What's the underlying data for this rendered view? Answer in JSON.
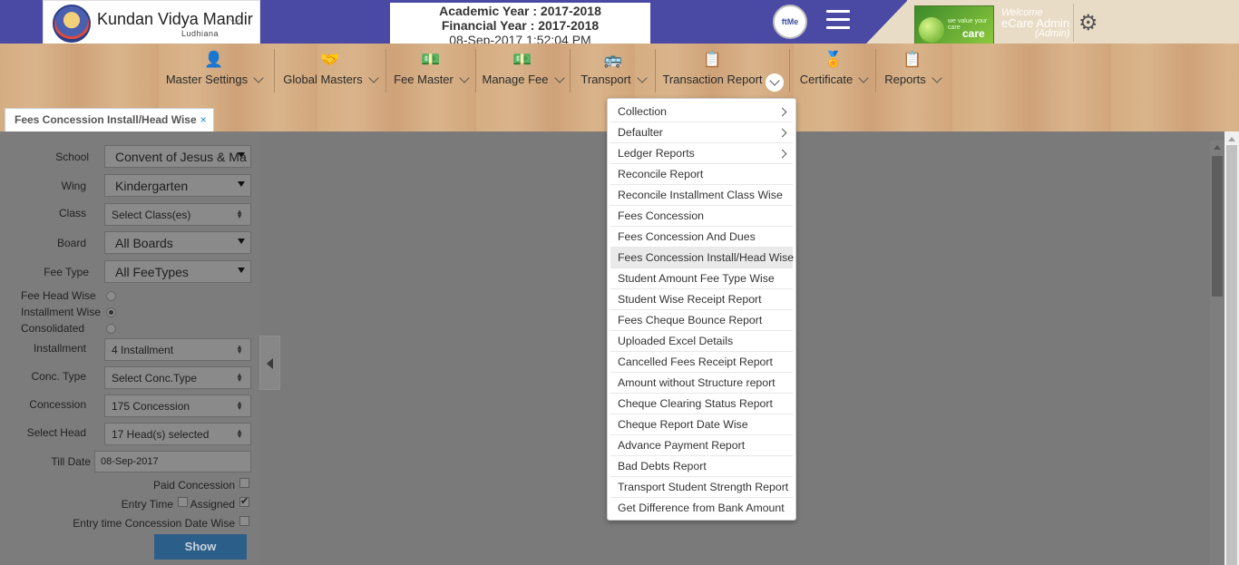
{
  "header": {
    "school_name": "Kundan Vidya Mandir",
    "school_city": "Ludhiana",
    "academic_year": "Academic Year : 2017-2018",
    "financial_year": "Financial Year : 2017-2018",
    "datetime": "08-Sep-2017 1:52:04 PM",
    "ecare_logo_text": "ftMe",
    "brand_tagline": "we value your care",
    "brand_text": "care",
    "welcome": "Welcome",
    "user_name": "eCare Admin",
    "user_role": "(Admin)",
    "colors": {
      "header_bg": "#4a4aa5",
      "accent_button": "#2c5e8a"
    }
  },
  "nav": {
    "items": [
      {
        "label": "Master Settings",
        "icon": "user-edit-icon"
      },
      {
        "label": "Global Masters",
        "icon": "handshake-icon"
      },
      {
        "label": "Fee Master",
        "icon": "money-icon"
      },
      {
        "label": "Manage Fee",
        "icon": "money-icon"
      },
      {
        "label": "Transport",
        "icon": "bus-icon"
      },
      {
        "label": "Transaction Report",
        "icon": "report-icon"
      },
      {
        "label": "Certificate",
        "icon": "certificate-icon"
      },
      {
        "label": "Reports",
        "icon": "report-icon"
      }
    ]
  },
  "tabs": {
    "active_label": "Fees Concession Install/Head Wise",
    "close_glyph": "×"
  },
  "form": {
    "school_label": "School",
    "school_value": "Convent of Jesus & Ma",
    "wing_label": "Wing",
    "wing_value": "Kindergarten",
    "class_label": "Class",
    "class_value": "Select Class(es)",
    "board_label": "Board",
    "board_value": "All Boards",
    "feetype_label": "Fee Type",
    "feetype_value": "All FeeTypes",
    "radio_head": "Fee Head Wise",
    "radio_install": "Installment Wise",
    "radio_consolidated": "Consolidated",
    "installment_label": "Installment",
    "installment_value": "4 Installment",
    "conctype_label": "Conc. Type",
    "conctype_value": "Select Conc.Type",
    "concession_label": "Concession",
    "concession_value": "175 Concession",
    "selecthead_label": "Select Head",
    "selecthead_value": "17 Head(s) selected",
    "tilldate_label": "Till Date",
    "tilldate_value": "08-Sep-2017",
    "paid_concession_label": "Paid Concession",
    "entry_time_label": "Entry Time",
    "assigned_label": "Assigned",
    "entry_date_wise_label": "Entry time Concession Date Wise",
    "show_label": "Show"
  },
  "dropdown": {
    "items": [
      {
        "label": "Collection",
        "submenu": true
      },
      {
        "label": "Defaulter",
        "submenu": true
      },
      {
        "label": "Ledger Reports",
        "submenu": true
      },
      {
        "label": "Reconcile Report"
      },
      {
        "label": "Reconcile Installment Class Wise"
      },
      {
        "label": "Fees Concession"
      },
      {
        "label": "Fees Concession And Dues"
      },
      {
        "label": "Fees Concession Install/Head Wise",
        "active": true
      },
      {
        "label": "Student Amount Fee Type Wise"
      },
      {
        "label": "Student Wise Receipt Report"
      },
      {
        "label": "Fees Cheque Bounce Report"
      },
      {
        "label": "Uploaded Excel Details"
      },
      {
        "label": "Cancelled Fees Receipt Report"
      },
      {
        "label": "Amount without Structure report"
      },
      {
        "label": "Cheque Clearing Status Report"
      },
      {
        "label": "Cheque Report Date Wise"
      },
      {
        "label": "Advance Payment Report"
      },
      {
        "label": "Bad Debts Report"
      },
      {
        "label": "Transport Student Strength Report"
      },
      {
        "label": "Get Difference from Bank Amount"
      }
    ]
  }
}
